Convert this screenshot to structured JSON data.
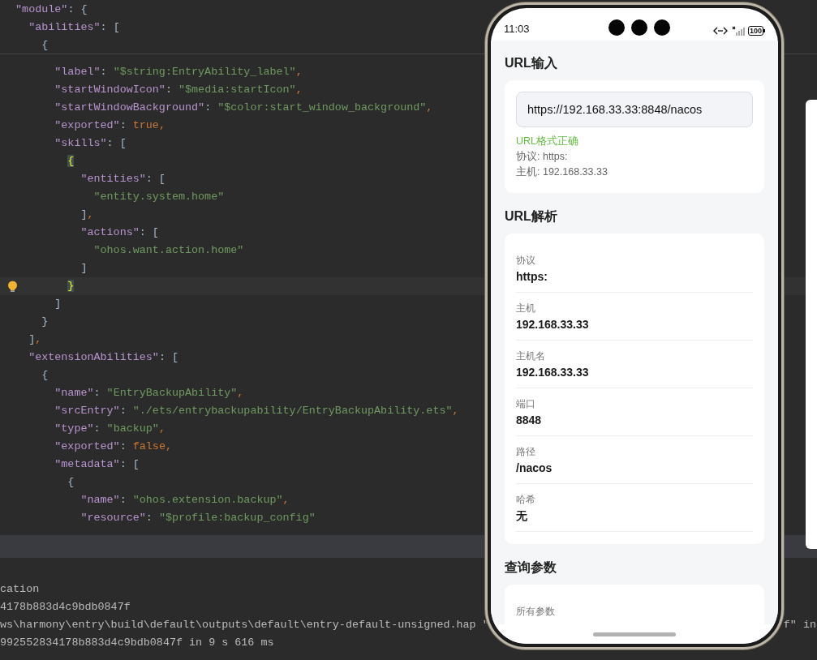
{
  "editor": {
    "sticky_lines": [
      {
        "text": "  \"module\": {"
      },
      {
        "text": "    \"abilities\": ["
      },
      {
        "text": "      {"
      }
    ],
    "lines": [
      {
        "text": "        \"label\": \"$string:EntryAbility_label\",",
        "current": false,
        "brace_match": false
      },
      {
        "text": "        \"startWindowIcon\": \"$media:startIcon\",",
        "current": false,
        "brace_match": false
      },
      {
        "text": "        \"startWindowBackground\": \"$color:start_window_background\",",
        "current": false,
        "brace_match": false
      },
      {
        "text": "        \"exported\": true,",
        "current": false,
        "brace_match": false
      },
      {
        "text": "        \"skills\": [",
        "current": false,
        "brace_match": false
      },
      {
        "text": "          {",
        "current": false,
        "brace_match": true
      },
      {
        "text": "            \"entities\": [",
        "current": false,
        "brace_match": false
      },
      {
        "text": "              \"entity.system.home\"",
        "current": false,
        "brace_match": false
      },
      {
        "text": "            ],",
        "current": false,
        "brace_match": false
      },
      {
        "text": "            \"actions\": [",
        "current": false,
        "brace_match": false
      },
      {
        "text": "              \"ohos.want.action.home\"",
        "current": false,
        "brace_match": false
      },
      {
        "text": "            ]",
        "current": false,
        "brace_match": false
      },
      {
        "text": "          }",
        "current": true,
        "brace_match": true
      },
      {
        "text": "        ]",
        "current": false,
        "brace_match": false
      },
      {
        "text": "      }",
        "current": false,
        "brace_match": false
      },
      {
        "text": "    ],",
        "current": false,
        "brace_match": false
      },
      {
        "text": "    \"extensionAbilities\": [",
        "current": false,
        "brace_match": false
      },
      {
        "text": "      {",
        "current": false,
        "brace_match": false
      },
      {
        "text": "        \"name\": \"EntryBackupAbility\",",
        "current": false,
        "brace_match": false
      },
      {
        "text": "        \"srcEntry\": \"./ets/entrybackupability/EntryBackupAbility.ets\",",
        "current": false,
        "brace_match": false
      },
      {
        "text": "        \"type\": \"backup\",",
        "current": false,
        "brace_match": false
      },
      {
        "text": "        \"exported\": false,",
        "current": false,
        "brace_match": false
      },
      {
        "text": "        \"metadata\": [",
        "current": false,
        "brace_match": false
      },
      {
        "text": "          {",
        "current": false,
        "brace_match": false
      },
      {
        "text": "            \"name\": \"ohos.extension.backup\",",
        "current": false,
        "brace_match": false
      },
      {
        "text": "            \"resource\": \"$profile:backup_config\"",
        "current": false,
        "brace_match": false
      }
    ]
  },
  "console": {
    "lines": [
      {
        "text": "cation"
      },
      {
        "text": "4178b883d4c9bdb0847f"
      },
      {
        "text": "ws\\harmony\\entry\\build\\default\\outputs\\default\\entry-default-unsigned.hap \"",
        "tail": "f\" in"
      },
      {
        "text": "992552834178b883d4c9bdb0847f in 9 s 616 ms"
      }
    ]
  },
  "phone": {
    "status_bar": {
      "time": "11:03",
      "battery": "100"
    },
    "sections": [
      {
        "title": "URL输入",
        "kind": "input",
        "value": "https://192.168.33.33:8848/nacos",
        "status": "URL格式正确",
        "details": [
          "协议: https:",
          "主机: 192.168.33.33"
        ]
      },
      {
        "title": "URL解析",
        "kind": "fields",
        "fields": [
          {
            "label": "协议",
            "value": "https:"
          },
          {
            "label": "主机",
            "value": "192.168.33.33"
          },
          {
            "label": "主机名",
            "value": "192.168.33.33"
          },
          {
            "label": "端口",
            "value": "8848"
          },
          {
            "label": "路径",
            "value": "/nacos"
          },
          {
            "label": "哈希",
            "value": "无"
          }
        ]
      },
      {
        "title": "查询参数",
        "kind": "fields",
        "fields": [
          {
            "label": "所有参数"
          }
        ]
      }
    ]
  }
}
